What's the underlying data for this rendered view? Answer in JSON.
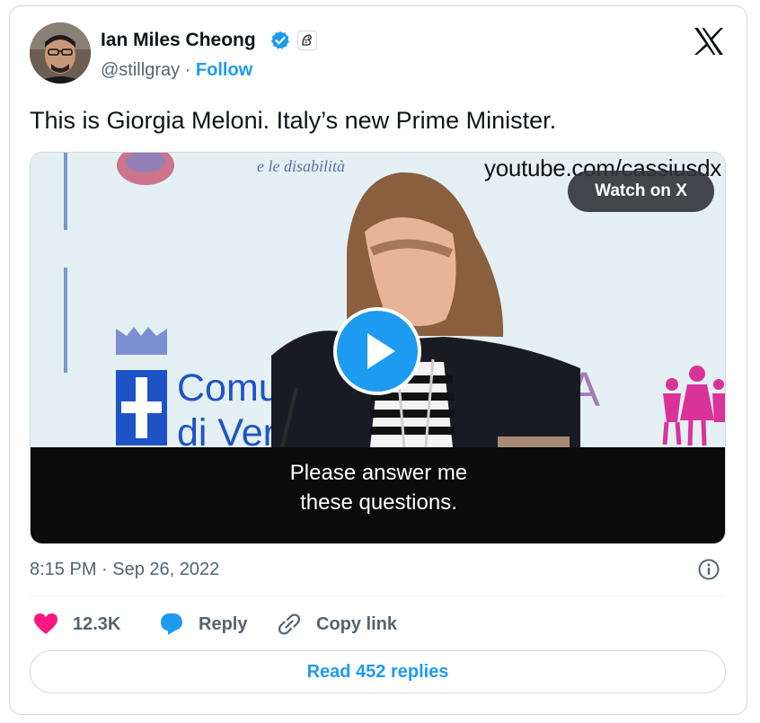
{
  "author": {
    "name": "Ian Miles Cheong",
    "handle": "@stillgray",
    "separator": "·",
    "follow_label": "Follow"
  },
  "tweet": {
    "text": "This is Giorgia Meloni. Italy’s new Prime Minister.",
    "timestamp": "8:15 PM · Sep 26, 2022"
  },
  "media": {
    "watermark": "youtube.com/cassiusdx",
    "watch_label": "Watch on X",
    "caption": "Please answer me\nthese questions.",
    "banner_words": [
      "Comune",
      "di Verona"
    ],
    "banner_script": "e le disabilità"
  },
  "actions": {
    "like_count": "12.3K",
    "reply_label": "Reply",
    "copy_label": "Copy link"
  },
  "footer": {
    "read_replies_label": "Read 452 replies"
  },
  "colors": {
    "accent": "#1d9bf0",
    "like": "#f91880",
    "muted": "#536471",
    "text": "#0f1419"
  },
  "icons": [
    "verified-badge-icon",
    "affiliation-badge-icon",
    "x-logo-icon",
    "play-icon",
    "info-icon",
    "heart-icon",
    "reply-bubble-icon",
    "link-icon"
  ]
}
